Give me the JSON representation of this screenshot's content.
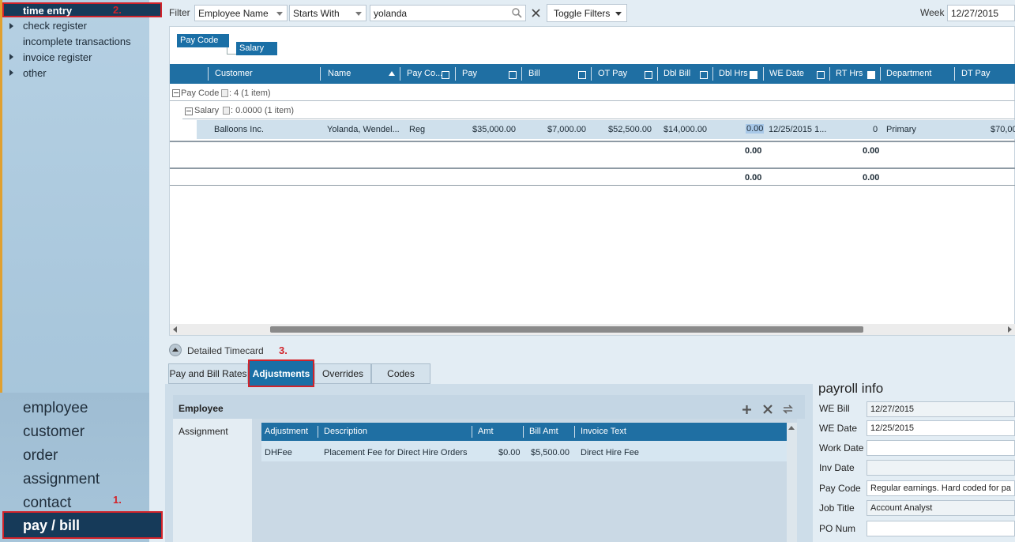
{
  "nav": {
    "time_entry": "time entry",
    "marker_2": "2.",
    "sub_items": [
      "check register",
      "incomplete transactions",
      "invoice register",
      "other"
    ],
    "main_items": [
      "employee",
      "customer",
      "order",
      "assignment",
      "contact"
    ],
    "pay_bill": "pay / bill",
    "marker_1": "1."
  },
  "filter": {
    "label": "Filter",
    "field": "Employee Name",
    "operator": "Starts With",
    "value": "yolanda",
    "toggle": "Toggle Filters",
    "week_label": "Week",
    "week_value": "12/27/2015"
  },
  "grouping": {
    "tag1": "Pay Code",
    "tag2": "Salary"
  },
  "grid": {
    "columns": [
      "Customer",
      "Name",
      "Pay Co...",
      "Pay",
      "Bill",
      "OT Pay",
      "Dbl Bill",
      "Dbl Hrs",
      "WE Date",
      "RT Hrs",
      "Department",
      "DT Pay"
    ],
    "group1": "Pay Code",
    "group1_info": ": 4 (1 item)",
    "group2": "Salary",
    "group2_info": ": 0.0000 (1 item)",
    "row": {
      "customer": "Balloons Inc.",
      "name": "Yolanda, Wendel...",
      "pay_code": "Reg",
      "pay": "$35,000.00",
      "bill": "$7,000.00",
      "ot_pay": "$52,500.00",
      "dbl_bill": "$14,000.00",
      "dbl_hrs": "0.00",
      "we_date": "12/25/2015 1...",
      "rt_hrs": "0",
      "department": "Primary",
      "dt_pay": "$70,00"
    },
    "subtotal1": {
      "dbl_hrs": "0.00",
      "rt_hrs": "0.00"
    },
    "subtotal2": {
      "dbl_hrs": "0.00",
      "rt_hrs": "0.00"
    }
  },
  "detail": {
    "toggle_label": "Detailed Timecard",
    "marker_3": "3.",
    "tabs": [
      "Pay and Bill Rates",
      "Adjustments",
      "Overrides",
      "Codes"
    ],
    "side": {
      "employee": "Employee",
      "assignment": "Assignment"
    },
    "adj_columns": [
      "Adjustment",
      "Description",
      "Amt",
      "Bill Amt",
      "Invoice Text"
    ],
    "adj_row": {
      "adjustment": "DHFee",
      "description": "Placement Fee for Direct Hire Orders",
      "amt": "$0.00",
      "bill_amt": "$5,500.00",
      "invoice_text": "Direct Hire Fee"
    }
  },
  "payroll": {
    "title": "payroll info",
    "fields": [
      {
        "label": "WE Bill",
        "value": "12/27/2015"
      },
      {
        "label": "WE Date",
        "value": "12/25/2015"
      },
      {
        "label": "Work Date",
        "value": ""
      },
      {
        "label": "Inv Date",
        "value": ""
      },
      {
        "label": "Pay Code",
        "value": "Regular earnings.  Hard coded for pa"
      },
      {
        "label": "Job Title",
        "value": "Account Analyst"
      },
      {
        "label": "PO Num",
        "value": ""
      }
    ]
  }
}
